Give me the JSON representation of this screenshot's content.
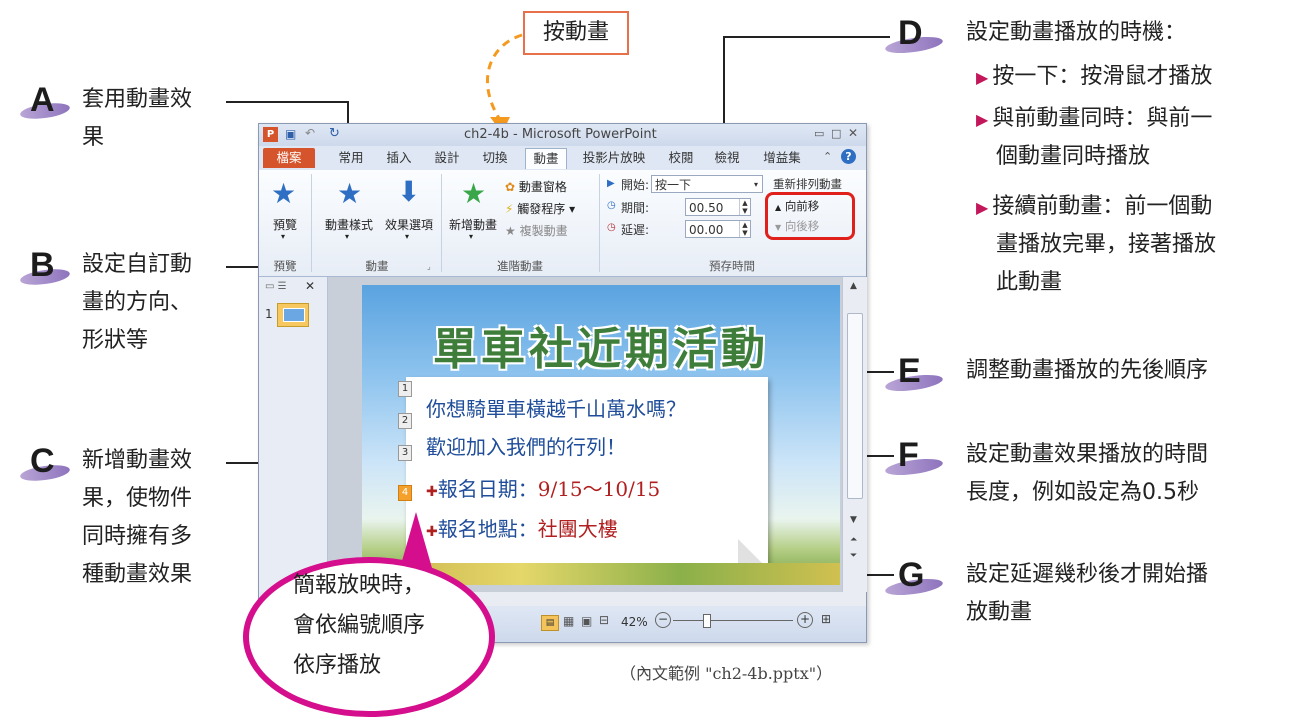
{
  "callout_button": "按動畫",
  "annotations": {
    "A": {
      "letter": "A",
      "lines": [
        "套用動畫效",
        "果"
      ]
    },
    "B": {
      "letter": "B",
      "lines": [
        "設定自訂動",
        "畫的方向、",
        "形狀等"
      ]
    },
    "C": {
      "letter": "C",
      "lines": [
        "新增動畫效",
        "果，使物件",
        "同時擁有多",
        "種動畫效果"
      ]
    },
    "D": {
      "letter": "D",
      "heading": "設定動畫播放的時機：",
      "bullets": [
        "按一下：按滑鼠才播放",
        "與前動畫同時：與前一",
        "個動畫同時播放",
        "接續前動畫：前一個動",
        "畫播放完畢，接著播放",
        "此動畫"
      ]
    },
    "E": {
      "letter": "E",
      "lines": [
        "調整動畫播放的先後順序"
      ]
    },
    "F": {
      "letter": "F",
      "lines": [
        "設定動畫效果播放的時間",
        "長度，例如設定為0.5秒"
      ]
    },
    "G": {
      "letter": "G",
      "lines": [
        "設定延遲幾秒後才開始播",
        "放動畫"
      ]
    }
  },
  "bubble_lines": [
    "簡報放映時，",
    "會依編號順序",
    "依序播放"
  ],
  "caption": "（內文範例 \"ch2-4b.pptx\"）",
  "window": {
    "title": "ch2-4b - Microsoft PowerPoint",
    "tabs": [
      "檔案",
      "常用",
      "插入",
      "設計",
      "切換",
      "動畫",
      "投影片放映",
      "校閱",
      "檢視",
      "增益集"
    ],
    "active_tab": "動畫",
    "ribbon": {
      "preview_label": "預覽",
      "group_preview": "預覽",
      "animation_styles": "動畫樣式",
      "effect_options": "效果選項",
      "group_animation": "動畫",
      "add_animation": "新增動畫",
      "animation_pane": "動畫窗格",
      "trigger": "觸發程序",
      "animation_painter": "複製動畫",
      "group_advanced": "進階動畫",
      "start_label": "開始:",
      "start_value": "按一下",
      "duration_label": "期間:",
      "duration_value": "00.50",
      "delay_label": "延遲:",
      "delay_value": "00.00",
      "group_timing": "預存時間",
      "reorder_title": "重新排列動畫",
      "move_earlier": "向前移",
      "move_later": "向後移"
    },
    "slide_number": "1",
    "zoom": "42%"
  },
  "slide": {
    "title": "單車社近期活動",
    "line1": "你想騎單車橫越千山萬水嗎？",
    "line2": "歡迎加入我們的行列！",
    "line3_label": "報名日期：",
    "line3_value": "9/15～10/15",
    "line4_label": "報名地點：",
    "line4_value": "社團大樓",
    "order_numbers": [
      "1",
      "2",
      "3",
      "4"
    ]
  },
  "colors": {
    "accent": "#d40e8c",
    "callout_border": "#e8704a",
    "highlight_box": "#e0201a"
  }
}
